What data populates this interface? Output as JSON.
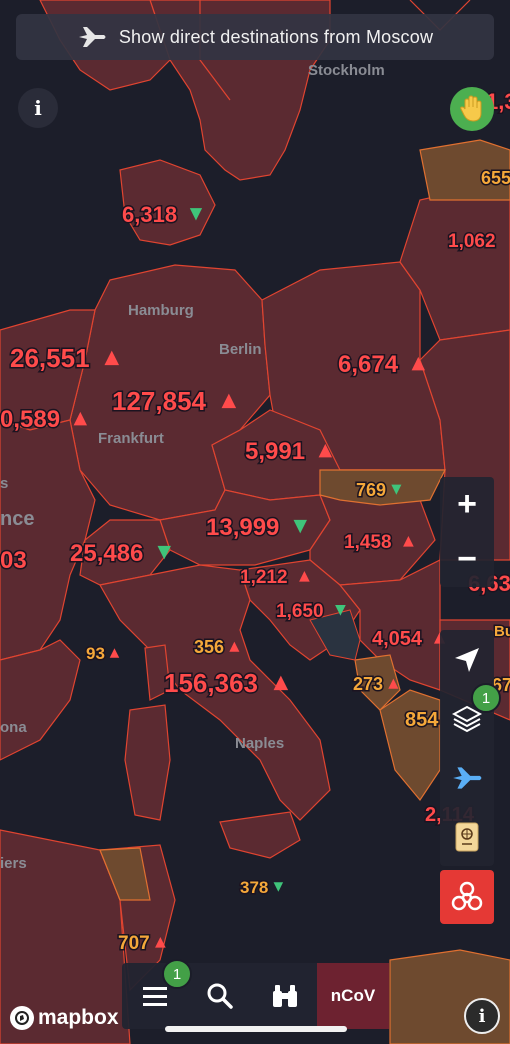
{
  "banner": {
    "text": "Show direct destinations from Moscow",
    "icon": "plane-icon"
  },
  "colors": {
    "red": "#ff4b4b",
    "orange": "#f5a83a",
    "green": "#3fc47a",
    "border": "#e04430"
  },
  "cities": [
    {
      "id": "stockholm",
      "name": "Stockholm"
    },
    {
      "id": "hamburg",
      "name": "Hamburg"
    },
    {
      "id": "berlin",
      "name": "Berlin"
    },
    {
      "id": "frankfurt",
      "name": "Frankfurt"
    },
    {
      "id": "naples",
      "name": "Naples"
    },
    {
      "id": "ona",
      "name": "ona"
    },
    {
      "id": "nce",
      "name": "nce"
    },
    {
      "id": "iers",
      "name": "iers"
    },
    {
      "id": "s",
      "name": "s"
    }
  ],
  "counts": [
    {
      "id": "denmark",
      "value": "6,318",
      "trend": "down",
      "color": "red"
    },
    {
      "id": "belgium",
      "value": "26,551",
      "trend": "up",
      "color": "red"
    },
    {
      "id": "germany",
      "value": "127,854",
      "trend": "up",
      "color": "red"
    },
    {
      "id": "poland",
      "value": "6,674",
      "trend": "up",
      "color": "red"
    },
    {
      "id": "france",
      "value": "0,589",
      "trend": "up",
      "color": "red"
    },
    {
      "id": "czechia",
      "value": "5,991",
      "trend": "up",
      "color": "red"
    },
    {
      "id": "slovakia",
      "value": "769",
      "trend": "down",
      "color": "orange"
    },
    {
      "id": "austria",
      "value": "13,999",
      "trend": "down",
      "color": "red"
    },
    {
      "id": "switzerland",
      "value": "25,486",
      "trend": "down",
      "color": "red"
    },
    {
      "id": "spain",
      "value": "03",
      "trend": "",
      "color": "red"
    },
    {
      "id": "hungary",
      "value": "1,458",
      "trend": "up",
      "color": "red"
    },
    {
      "id": "slovenia",
      "value": "1,212",
      "trend": "up",
      "color": "red"
    },
    {
      "id": "croatia",
      "value": "1,650",
      "trend": "down",
      "color": "red"
    },
    {
      "id": "monaco",
      "value": "93",
      "trend": "up",
      "color": "orange"
    },
    {
      "id": "sanmarino",
      "value": "356",
      "trend": "up",
      "color": "orange"
    },
    {
      "id": "italy",
      "value": "156,363",
      "trend": "up",
      "color": "red"
    },
    {
      "id": "serbia",
      "value": "4,054",
      "trend": "up",
      "color": "red"
    },
    {
      "id": "montenegro",
      "value": "273",
      "trend": "up",
      "color": "orange"
    },
    {
      "id": "macedonia",
      "value": "854",
      "trend": "",
      "color": "orange"
    },
    {
      "id": "greece",
      "value": "2,114",
      "trend": "",
      "color": "red"
    },
    {
      "id": "malta",
      "value": "378",
      "trend": "down",
      "color": "orange"
    },
    {
      "id": "tunisia",
      "value": "707",
      "trend": "up",
      "color": "orange"
    },
    {
      "id": "latvia",
      "value": "655",
      "trend": "",
      "color": "orange"
    },
    {
      "id": "belarus",
      "value": "1,062",
      "trend": "",
      "color": "red"
    },
    {
      "id": "romania",
      "value": "6,63",
      "trend": "",
      "color": "red"
    },
    {
      "id": "estonia",
      "value": "1,3",
      "trend": "",
      "color": "red"
    },
    {
      "id": "bulgaria",
      "value": "67",
      "trend": "",
      "color": "orange"
    },
    {
      "id": "bu",
      "value": "Bu",
      "trend": "",
      "color": "orange"
    }
  ],
  "controls": {
    "info_label": "i",
    "zoom_in": "+",
    "zoom_out": "−",
    "layers_badge": "1",
    "menu_badge": "1",
    "ncov_label": "nCoV",
    "mapbox_label": "mapbox",
    "attribution_label": "i"
  }
}
